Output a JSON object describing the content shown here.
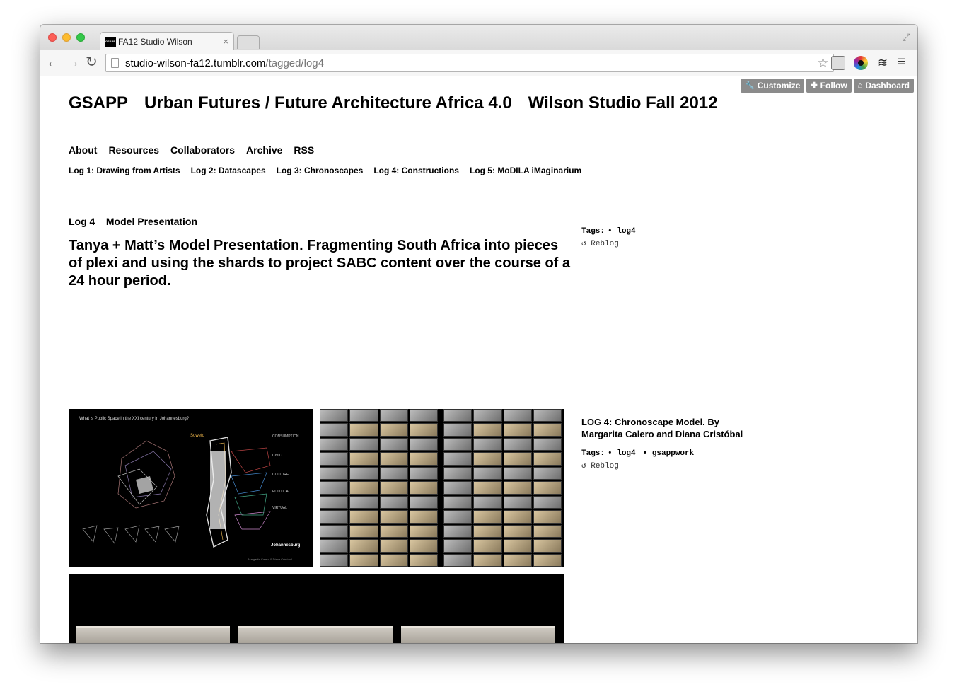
{
  "browser": {
    "tab_title": "FA12 Studio Wilson",
    "favicon_text": "GSAPP",
    "url_host": "studio-wilson-fa12.tumblr.com",
    "url_path": "/tagged/log4"
  },
  "tumblr": {
    "customize": "Customize",
    "follow": "Follow",
    "dashboard": "Dashboard"
  },
  "site": {
    "title_parts": [
      "GSAPP",
      "Urban Futures / Future Architecture Africa 4.0",
      "Wilson Studio Fall 2012"
    ]
  },
  "nav": {
    "main": [
      "About",
      "Resources",
      "Collaborators",
      "Archive",
      "RSS"
    ],
    "logs": [
      "Log 1: Drawing from Artists",
      "Log 2: Datascapes",
      "Log 3: Chronoscapes",
      "Log 4: Constructions",
      "Log 5: MoDILA iMaginarium"
    ]
  },
  "post1": {
    "title": "Log 4 _ Model Presentation",
    "body": "Tanya + Matt’s Model Presentation. Fragmenting South Africa into pieces of plexi and using the shards to project SABC content over the course of a 24 hour period.",
    "tags_label": "Tags:",
    "tags": [
      "• log4"
    ],
    "reblog": "↺ Reblog"
  },
  "post2": {
    "caption": "LOG 4: Chronoscape Model. By Margarita Calero and Diana Cristóbal",
    "tags_label": "Tags:",
    "tags": [
      "• log4",
      "• gsappwork"
    ],
    "reblog": "↺ Reblog",
    "image1": {
      "heading": "What is Public Space in the XXI century in Johannesburg?",
      "soweto": "Soweto",
      "labels": [
        "CONSUMPTION",
        "CIVIC",
        "CULTURE",
        "POLITICAL",
        "VIRTUAL"
      ],
      "city": "Johannesburg",
      "credit": "Margarita Calero & Diana Cristóbal"
    }
  }
}
